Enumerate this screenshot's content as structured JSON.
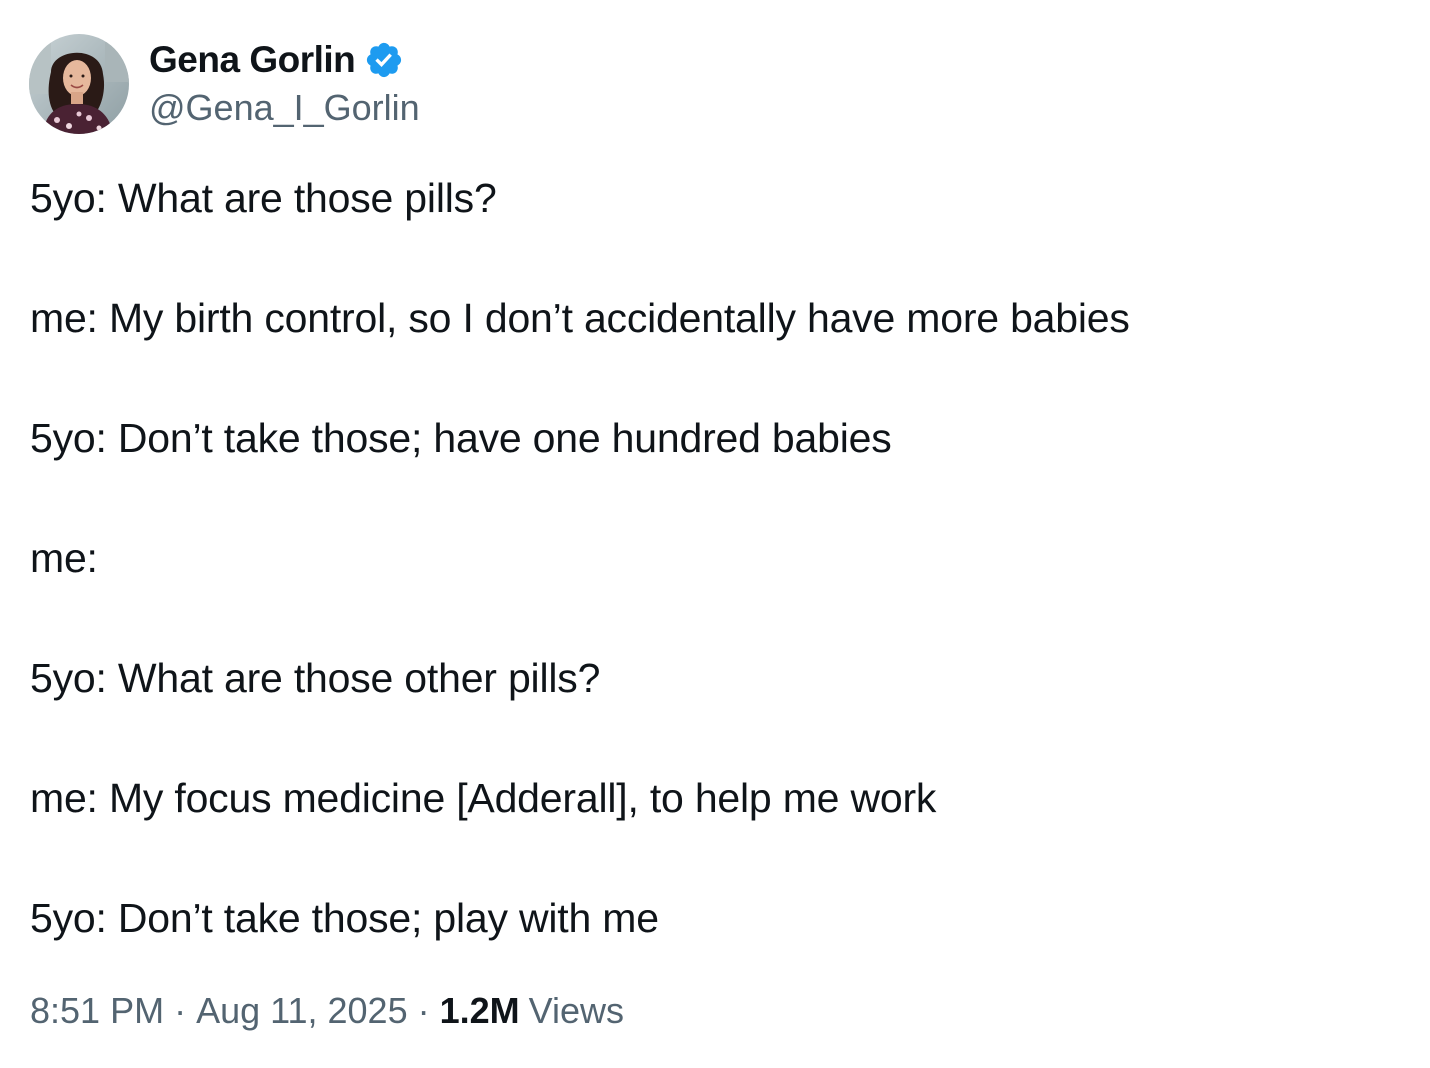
{
  "author": {
    "name": "Gena Gorlin",
    "handle": "@Gena_I_Gorlin",
    "verified": true,
    "verified_color": "#1d9bf0"
  },
  "tweet": {
    "lines": [
      "5yo: What are those pills?",
      "me: My birth control, so I don’t accidentally have more babies",
      "5yo: Don’t take those; have one hundred babies",
      "me:",
      "5yo: What are those other pills?",
      "me: My focus medicine [Adderall], to help me work",
      "5yo: Don’t take those; play with me"
    ]
  },
  "meta": {
    "time": "8:51 PM",
    "separator": "·",
    "date": "Aug 11, 2025",
    "views_count": "1.2M",
    "views_label": "Views"
  },
  "colors": {
    "text": "#0f1419",
    "secondary": "#536471",
    "background": "#ffffff"
  },
  "icons": {
    "verified": "verified-badge-icon",
    "avatar": "profile-photo"
  }
}
